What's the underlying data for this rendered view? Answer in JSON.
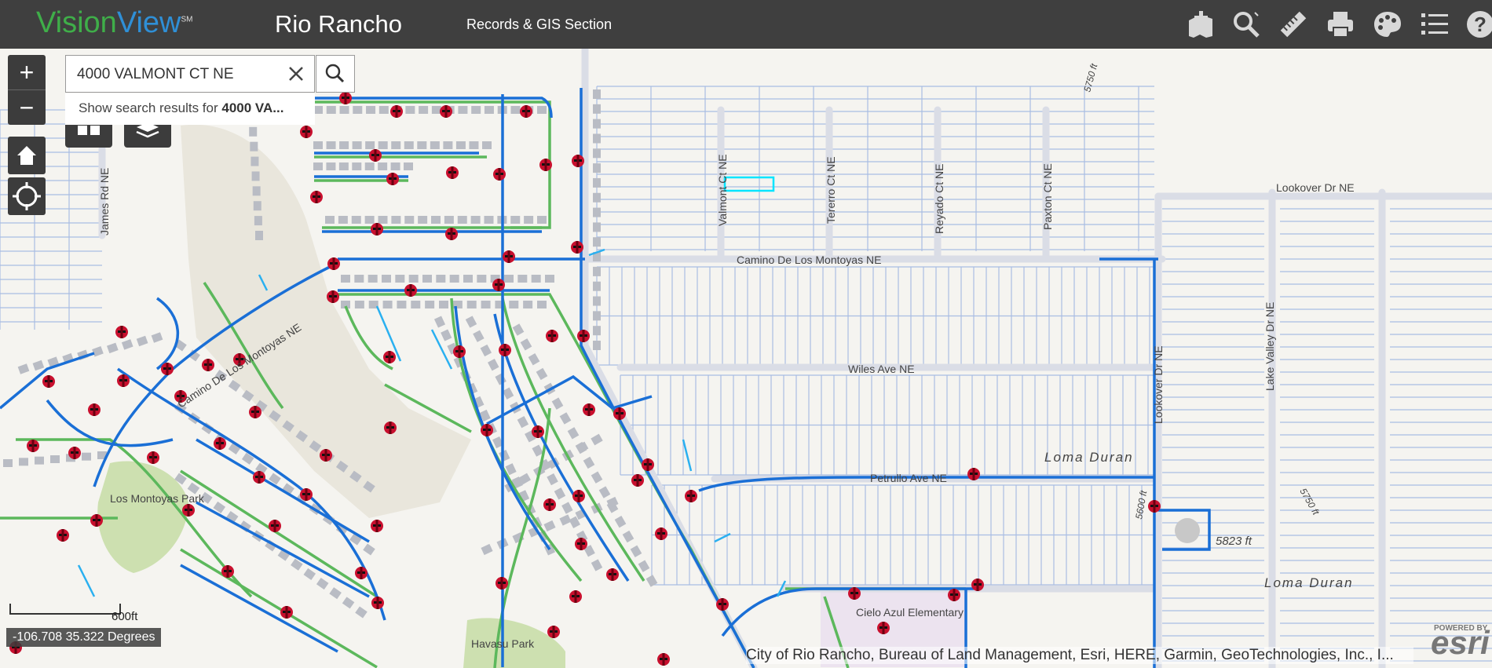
{
  "header": {
    "logo_part1": "Vision",
    "logo_part2": "View",
    "logo_mark": "SM",
    "app_title": "Rio Rancho",
    "section_title": "Records & GIS Section"
  },
  "toolbar": {
    "tools": [
      "add-data-icon",
      "search-icon",
      "measure-icon",
      "print-icon",
      "basemap-palette-icon",
      "layer-list-icon",
      "help-icon"
    ]
  },
  "search": {
    "value": "4000 VALMONT CT NE",
    "suggestion_prefix": "Show search results for ",
    "suggestion_term": "4000 VA..."
  },
  "map": {
    "street_labels": [
      "James Rd NE",
      "Valmont Ct NE",
      "Tererro Ct NE",
      "Reyado Ct NE",
      "Paxton Ct NE",
      "Lookover Dr NE",
      "Camino De Los Montoyas NE",
      "Wiles Ave NE",
      "Lake Valley Dr NE",
      "Petrullo Ave NE",
      "Lookover Dr NE",
      "Camino De Los Montoyas NE"
    ],
    "area_labels": [
      "Loma Duran",
      "Loma Duran",
      "Los Montoyas Park",
      "Havasu Park",
      "Cielo Azul Elementary"
    ],
    "elevation_labels": [
      "5823 ft",
      "5750 ft",
      "5600 ft",
      "5750 ft"
    ],
    "scale_label": "600ft",
    "coordinates": "-106.708 35.322 Degrees",
    "attribution": "City of Rio Rancho, Bureau of Land Management, Esri, HERE, Garmin, GeoTechnologies, Inc., I...",
    "esri_powered": "POWERED BY",
    "esri_logo": "esri"
  },
  "controls": {
    "zoom_in": "+",
    "zoom_out": "−"
  },
  "colors": {
    "header_bg": "#3f3f3f",
    "water_line": "#1a6fd6",
    "water_line_light": "#2ab0f0",
    "sewer_line": "#5cb85c",
    "hydrant": "#c8102e",
    "parcel": "#a9bde3",
    "building": "#b9bcc4",
    "park": "#cde0b0",
    "selected_parcel": "#00e5ff"
  }
}
